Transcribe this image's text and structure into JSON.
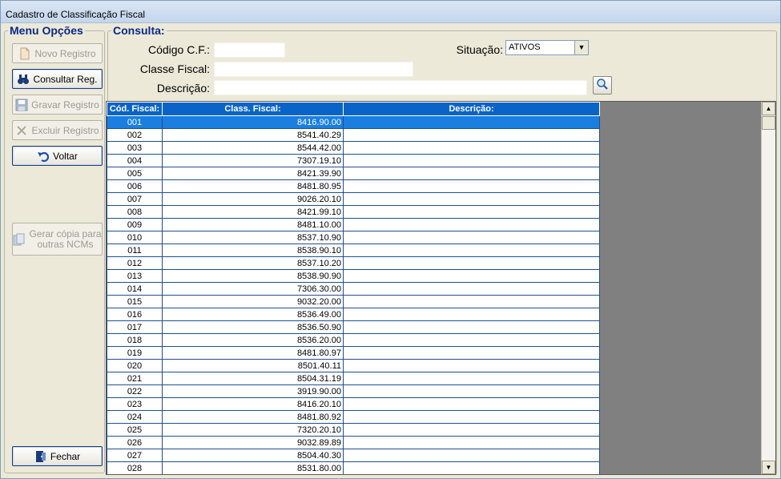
{
  "window": {
    "title": "Cadastro de Classificação Fiscal"
  },
  "menu": {
    "legend": "Menu Opções",
    "buttons": {
      "novo": "Novo Registro",
      "consultar": "Consultar Reg.",
      "gravar": "Gravar Registro",
      "excluir": "Excluir Registro",
      "voltar": "Voltar",
      "gerar_line1": "Gerar cópia para",
      "gerar_line2": "outras NCMs",
      "fechar": "Fechar"
    }
  },
  "consulta": {
    "legend": "Consulta:",
    "codigo_label": "Código C.F.:",
    "codigo_value": "",
    "classe_label": "Classe Fiscal:",
    "classe_value": "",
    "descricao_label": "Descrição:",
    "descricao_value": "",
    "situacao_label": "Situação:",
    "situacao_value": "ATIVOS"
  },
  "grid": {
    "columns": [
      "Cód. Fiscal:",
      "Class. Fiscal:",
      "Descrição:"
    ],
    "selected_index": 0,
    "rows": [
      [
        "001",
        "8416.90.00",
        ""
      ],
      [
        "002",
        "8541.40.29",
        ""
      ],
      [
        "003",
        "8544.42.00",
        ""
      ],
      [
        "004",
        "7307.19.10",
        ""
      ],
      [
        "005",
        "8421.39.90",
        ""
      ],
      [
        "006",
        "8481.80.95",
        ""
      ],
      [
        "007",
        "9026.20.10",
        ""
      ],
      [
        "008",
        "8421.99.10",
        ""
      ],
      [
        "009",
        "8481.10.00",
        ""
      ],
      [
        "010",
        "8537.10.90",
        ""
      ],
      [
        "011",
        "8538.90.10",
        ""
      ],
      [
        "012",
        "8537.10.20",
        ""
      ],
      [
        "013",
        "8538.90.90",
        ""
      ],
      [
        "014",
        "7306.30.00",
        ""
      ],
      [
        "015",
        "9032.20.00",
        ""
      ],
      [
        "016",
        "8536.49.00",
        ""
      ],
      [
        "017",
        "8536.50.90",
        ""
      ],
      [
        "018",
        "8536.20.00",
        ""
      ],
      [
        "019",
        "8481.80.97",
        ""
      ],
      [
        "020",
        "8501.40.11",
        ""
      ],
      [
        "021",
        "8504.31.19",
        ""
      ],
      [
        "022",
        "3919.90.00",
        ""
      ],
      [
        "023",
        "8416.20.10",
        ""
      ],
      [
        "024",
        "8481.80.92",
        ""
      ],
      [
        "025",
        "7320.20.10",
        ""
      ],
      [
        "026",
        "9032.89.89",
        ""
      ],
      [
        "027",
        "8504.40.30",
        ""
      ],
      [
        "028",
        "8531.80.00",
        ""
      ]
    ]
  }
}
